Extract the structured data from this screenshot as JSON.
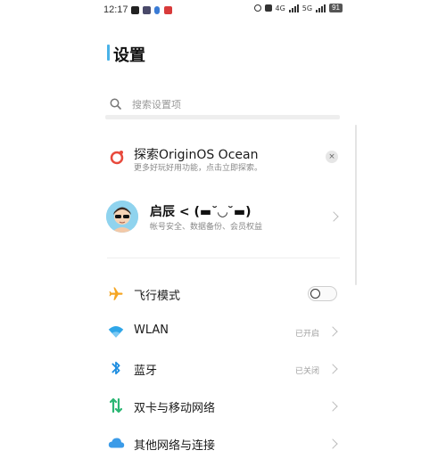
{
  "status_bar": {
    "time": "12:17",
    "signal_1": "4G",
    "signal_2": "5G",
    "battery": "91"
  },
  "page": {
    "title": "设置"
  },
  "search": {
    "placeholder": "搜索设置项"
  },
  "promo": {
    "title": "探索OriginOS Ocean",
    "subtitle": "更多好玩好用功能，点击立即探索。",
    "close_glyph": "×"
  },
  "account": {
    "name": "启辰 < (▬˘◡˘▬)",
    "subtitle": "帐号安全、数据备份、会员权益"
  },
  "settings": {
    "airplane": {
      "label": "飞行模式",
      "enabled": false
    },
    "wlan": {
      "label": "WLAN",
      "value": "已开启"
    },
    "bluetooth": {
      "label": "蓝牙",
      "value": "已关闭"
    },
    "dual_sim": {
      "label": "双卡与移动网络"
    },
    "other_network": {
      "label": "其他网络与连接"
    }
  },
  "colors": {
    "title_accent": "#4ab3e8",
    "airplane_icon": "#f5a623",
    "wlan_icon": "#2fa6e8",
    "bluetooth_icon": "#1d8de0",
    "dual_sim_icon": "#2bb673",
    "cloud_icon": "#3b9be8",
    "promo_icon": "#e8493c"
  },
  "icons": {
    "airplane": "airplane-icon",
    "wlan": "wifi-icon",
    "bluetooth": "bluetooth-icon",
    "dual_sim": "dual-sim-icon",
    "other_network": "cloud-icon",
    "promo": "origin-os-icon",
    "search": "search-icon"
  }
}
